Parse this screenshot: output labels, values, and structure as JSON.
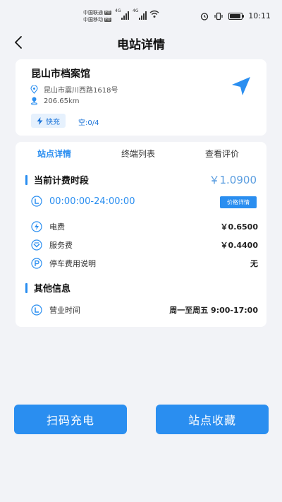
{
  "status_bar": {
    "carrier1": "中国联通",
    "carrier2": "中国移动",
    "hd": "HD",
    "net1": "4G",
    "net2": "4G",
    "time": "10:11"
  },
  "nav": {
    "title": "电站详情"
  },
  "station": {
    "name": "昆山市档案馆",
    "address": "昆山市震川西路1618号",
    "distance": "206.65km",
    "fast_label": "快充",
    "vacancy": "空:0/4"
  },
  "tabs": [
    {
      "label": "站点详情",
      "active": true
    },
    {
      "label": "终端列表",
      "active": false
    },
    {
      "label": "查看评价",
      "active": false
    }
  ],
  "billing": {
    "title": "当前计费时段",
    "price": "￥1.0900",
    "period": "00:00:00-24:00:00",
    "detail_button": "价格详情",
    "fees": [
      {
        "label": "电费",
        "value": "￥0.6500",
        "icon": "lightning-icon"
      },
      {
        "label": "服务费",
        "value": "￥0.4400",
        "icon": "service-icon"
      },
      {
        "label": "停车费用说明",
        "value": "无",
        "icon": "parking-icon"
      }
    ]
  },
  "other": {
    "title": "其他信息",
    "hours_label": "营业时间",
    "hours_value": "周一至周五 9:00-17:00"
  },
  "buttons": {
    "scan": "扫码充电",
    "favorite": "站点收藏"
  },
  "colors": {
    "accent": "#2a8ef0",
    "background": "#f2f3f7"
  }
}
